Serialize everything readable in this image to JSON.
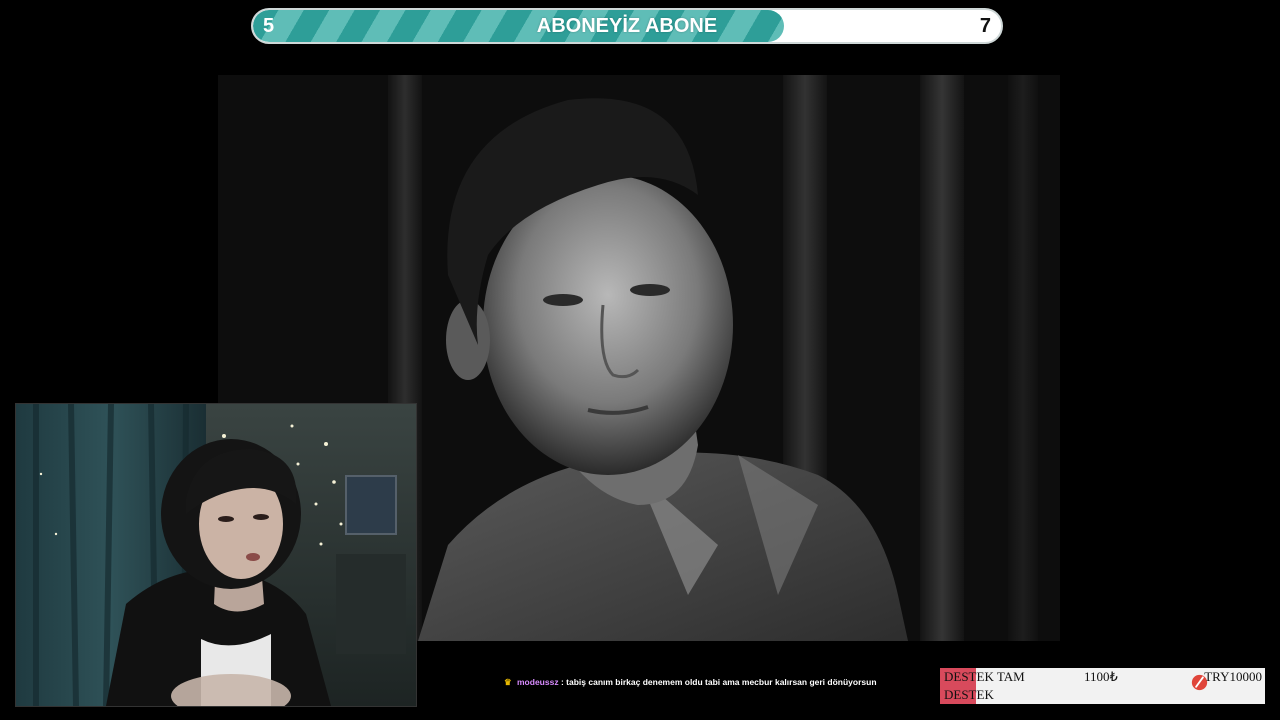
{
  "goal_bar": {
    "title": "ABONEYİZ ABONE",
    "start": "5",
    "end": "7",
    "progress": 0.71,
    "fill_color": "#2e9e98",
    "stripe_color": "#5fbdb7"
  },
  "chat": {
    "badge_icon": "crown-icon",
    "username": "modeussz",
    "separator": ":",
    "message": "tabiş canım birkaç denemem oldu tabi ama mecbur kalırsan geri dönüyorsun"
  },
  "donation": {
    "title_line1": "DESTEK TAM",
    "title_line2": "DESTEK",
    "current": "1100₺",
    "target": "TRY10000",
    "progress": 0.11,
    "bar_color": "#d84a5c",
    "logo_icon": "donation-logo-icon"
  }
}
